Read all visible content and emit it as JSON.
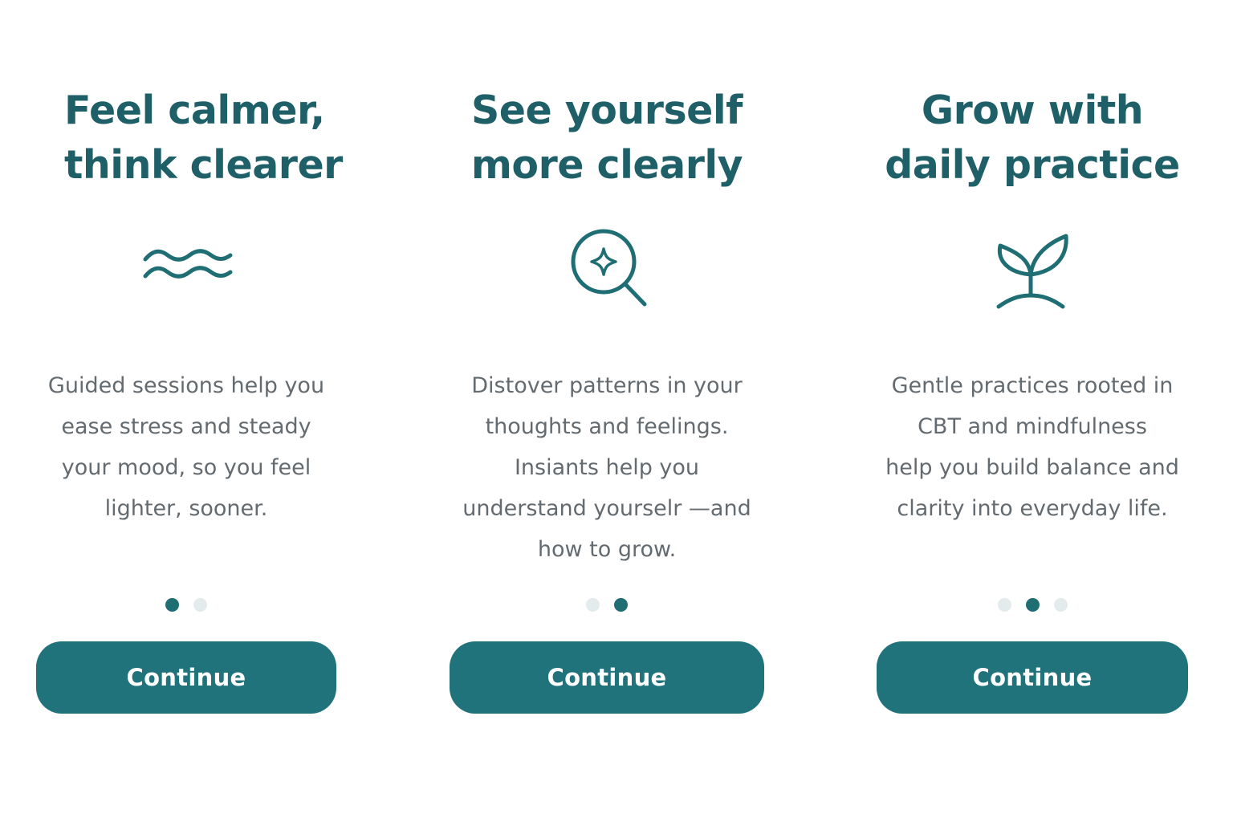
{
  "screens": [
    {
      "title_lines": [
        "Feel calmer,",
        "think clearer"
      ],
      "icon": "waves-icon",
      "description_lines": [
        "Guided sessions help you",
        "ease stress and steady",
        "your mood, so you feel",
        "lighter, sooner."
      ],
      "pager": {
        "total": 2,
        "active": 1
      },
      "button_label": "Continue"
    },
    {
      "title_lines": [
        "See yourself",
        "more clearly"
      ],
      "icon": "magnifier-sparkle-icon",
      "description_lines": [
        "Distover patterns in your",
        "thoughts and feelings.",
        "Insiants help you",
        "understand yourselr —and",
        "how to grow."
      ],
      "pager": {
        "total": 2,
        "active": 2
      },
      "button_label": "Continue"
    },
    {
      "title_lines": [
        "Grow with",
        "daily practice"
      ],
      "icon": "sprout-icon",
      "description_lines": [
        "Gentle practices rooted in",
        "CBT and mindfulness",
        "help you build balance and",
        "clarity into everyday life."
      ],
      "pager": {
        "total": 3,
        "active": 2
      },
      "button_label": "Continue"
    }
  ],
  "colors": {
    "accent": "#20737a",
    "title": "#1f6068",
    "body_text": "#646b70",
    "dot_inactive": "#e4ebec",
    "dot_active": "#1f6e73",
    "background": "#ffffff"
  }
}
